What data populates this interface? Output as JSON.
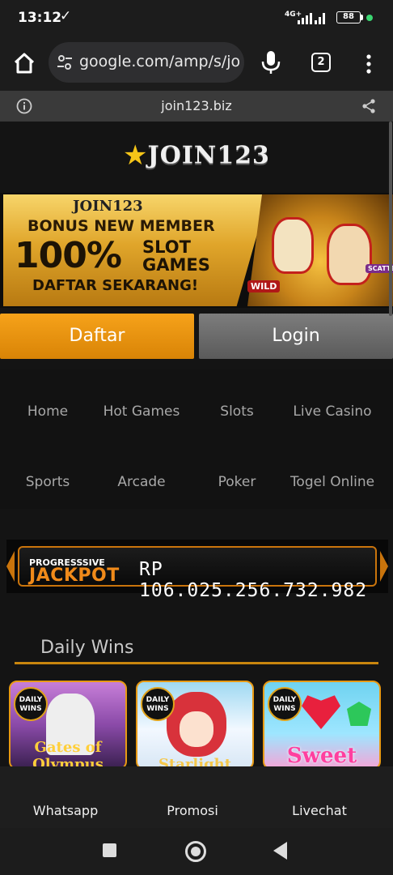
{
  "status_bar": {
    "time": "13:12",
    "check": "✓",
    "network": "4G+",
    "battery": "88"
  },
  "browser": {
    "url": "google.com/amp/s/jo",
    "tab_count": "2",
    "amp_domain": "join123.biz"
  },
  "site": {
    "logo_text": "JOIN123",
    "banner": {
      "logo": "JOIN123",
      "line1": "BONUS NEW MEMBER",
      "big": "100%",
      "slot_line1": "SLOT",
      "slot_line2": "GAMES",
      "cta": "DAFTAR SEKARANG!",
      "wild": "WILD",
      "scatter": "SCATTER"
    },
    "buttons": {
      "daftar": "Daftar",
      "login": "Login"
    },
    "nav": [
      "Home",
      "Hot Games",
      "Slots",
      "Live Casino",
      "Sports",
      "Arcade",
      "Poker",
      "Togel Online"
    ],
    "jackpot": {
      "label_small": "PROGRESSSIVE",
      "label_big": "JACKPOT",
      "amount": "RP 106.025.256.732.982"
    },
    "daily_wins": {
      "title": "Daily Wins",
      "cards": [
        {
          "badge": "DAILY WINS",
          "title": "Gates of Olympus"
        },
        {
          "badge": "DAILY WINS",
          "title": "Starlight"
        },
        {
          "badge": "DAILY WINS",
          "title": "Sweet"
        }
      ]
    }
  },
  "bottom_nav": [
    "Whatsapp",
    "Promosi",
    "Livechat"
  ],
  "colors": {
    "accent_orange": "#f6a21a",
    "gold": "#c9860e",
    "dark_bg": "#141414"
  }
}
